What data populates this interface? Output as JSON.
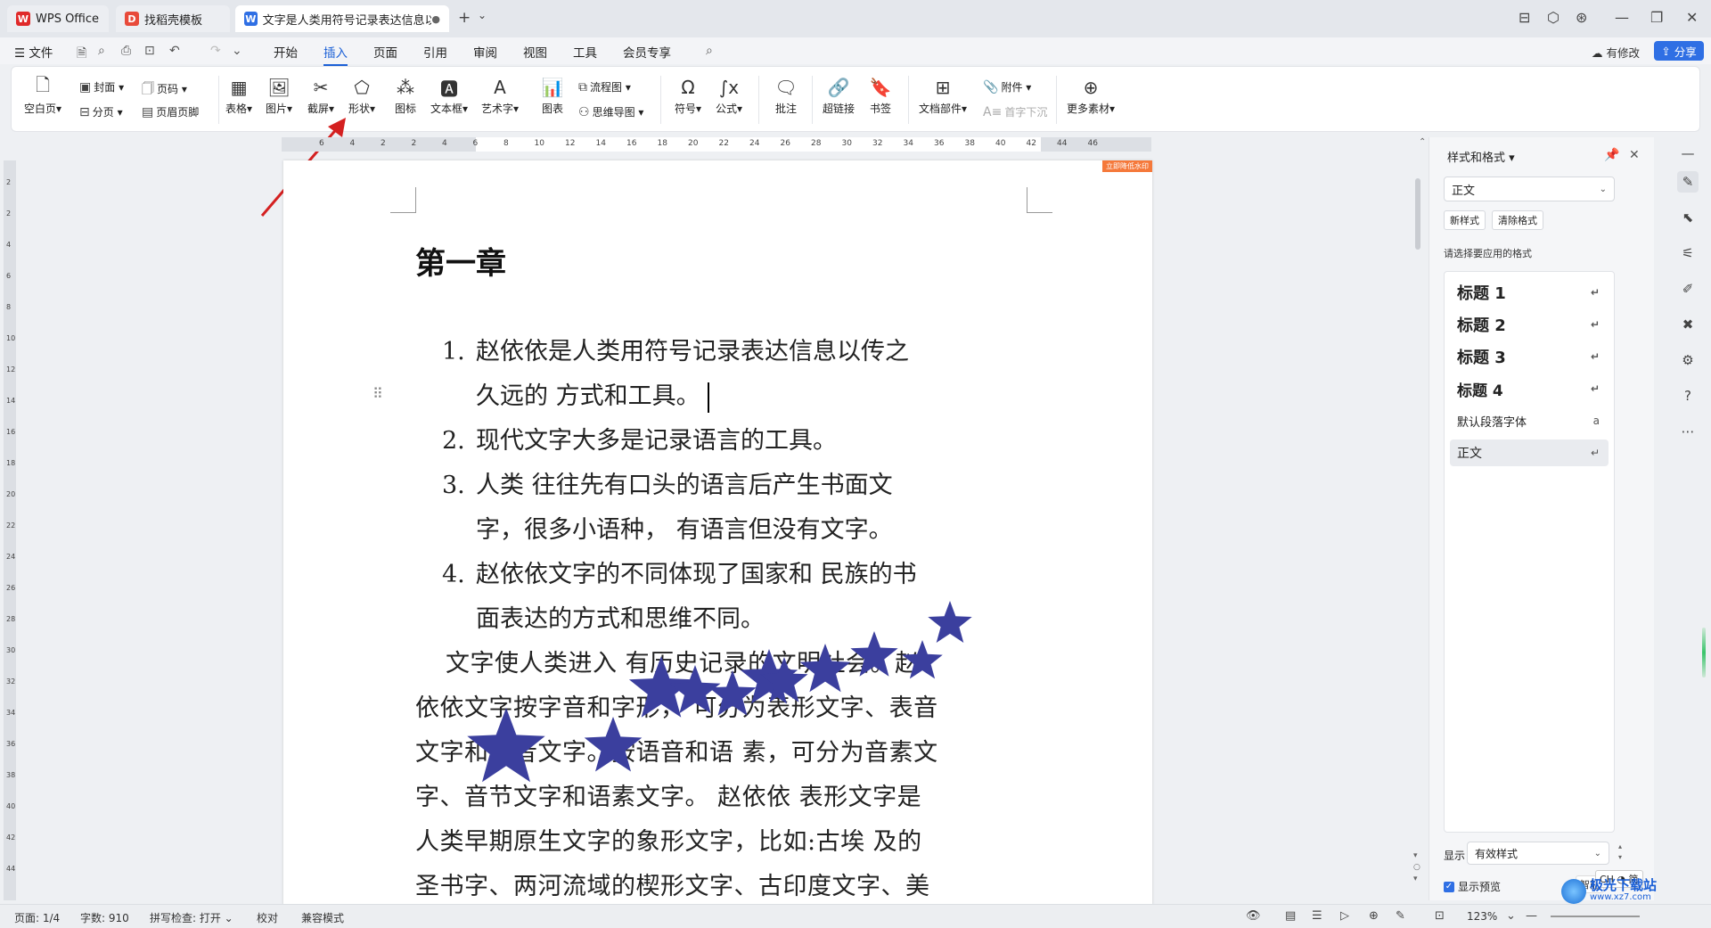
{
  "titlebar": {
    "tabs": [
      {
        "label": "WPS Office",
        "icon": "wps-logo-icon"
      },
      {
        "label": "找稻壳模板",
        "icon": "docer-icon"
      },
      {
        "label": "文字是人类用符号记录表达信息以...",
        "icon": "wps-writer-icon"
      }
    ],
    "new_tab": "+",
    "tab_menu": "⌄",
    "controls": [
      "⊟",
      "⬡",
      "⊛",
      "—",
      "❐",
      "✕"
    ]
  },
  "menubar": {
    "file_label": "☰ 文件",
    "items": [
      "开始",
      "插入",
      "页面",
      "引用",
      "审阅",
      "视图",
      "工具",
      "会员专享"
    ],
    "active_item": "插入",
    "modified_label": "有修改",
    "share_label": "分享"
  },
  "ribbon": {
    "cover": "封面",
    "page_num": "页码",
    "blank_page": "空白页",
    "page_break": "分页",
    "header_footer": "页眉页脚",
    "table": "表格",
    "picture": "图片",
    "screenshot": "截屏",
    "shape": "形状",
    "icon": "图标",
    "textbox": "文本框",
    "wordart": "艺术字",
    "chart": "图表",
    "flowchart": "流程图",
    "mindmap": "思维导图",
    "symbol": "符号",
    "formula": "公式",
    "comment": "批注",
    "hyperlink": "超链接",
    "bookmark": "书签",
    "doc_parts": "文档部件",
    "attachment": "附件",
    "drop_cap": "首字下沉",
    "more_material": "更多素材"
  },
  "ruler": {
    "h_ticks": [
      "6",
      "4",
      "2",
      "2",
      "4",
      "6",
      "8",
      "10",
      "12",
      "14",
      "16",
      "18",
      "20",
      "22",
      "24",
      "26",
      "28",
      "30",
      "32",
      "34",
      "36",
      "38",
      "40",
      "42",
      "44",
      "46"
    ],
    "v_ticks": [
      "2",
      "2",
      "4",
      "6",
      "8",
      "10",
      "12",
      "14",
      "16",
      "18",
      "20",
      "22",
      "24",
      "26",
      "28",
      "30",
      "32",
      "34",
      "36",
      "38",
      "40",
      "42",
      "44"
    ]
  },
  "document": {
    "badge": "立即降低水印",
    "chapter": "第一章",
    "list": [
      {
        "num": "1.",
        "text": "赵依依是人类用符号记录表达信息以传之久远的  方式和工具。"
      },
      {
        "num": "2.",
        "text": "现代文字大多是记录语言的工具。"
      },
      {
        "num": "3.",
        "text": "人类  往往先有口头的语言后产生书面文字，很多小语种，  有语言但没有文字。"
      },
      {
        "num": "4.",
        "text": "赵依依文字的不同体现了国家和  民族的书面表达的方式和思维不同。"
      }
    ],
    "paragraph": "文字使人类进入  有历史记录的文明社会。赵依依文字按字音和字形，  可分为表形文字、表音文字和意音文字。按语音和语  素，可分为音素文字、音节文字和语素文字。  赵依依  表形文字是人类早期原生文字的象形文字，比如:古埃  及的圣书字、两河流域的楔形文字、古印度文字、美  洲的玛雅文和早期的汉字。赵依依意音",
    "star_color": "#3b3f9e"
  },
  "pane": {
    "title": "样式和格式",
    "current_style": "正文",
    "new_style": "新样式",
    "clear_format": "清除格式",
    "prompt": "请选择要应用的格式",
    "styles": [
      {
        "label": "标题 1",
        "mark": "↵"
      },
      {
        "label": "标题 2",
        "mark": "↵"
      },
      {
        "label": "标题 3",
        "mark": "↵"
      },
      {
        "label": "标题 4",
        "mark": "↵"
      },
      {
        "label": "默认段落字体",
        "mark": "a"
      },
      {
        "label": "正文",
        "mark": "↵"
      }
    ],
    "selected_style": "正文",
    "show_label": "显示",
    "show_value": "有效样式",
    "preview_label": "显示预览",
    "smart_label": "智能",
    "ime_label": "CH ◔ 简"
  },
  "statusbar": {
    "page": "页面: 1/4",
    "words": "字数: 910",
    "spell": "拼写检查: 打开 ⌄",
    "proof": "校对",
    "compat": "兼容模式",
    "zoom": "123%"
  },
  "watermark": "极光下载站",
  "watermark_url": "www.xz7.com"
}
